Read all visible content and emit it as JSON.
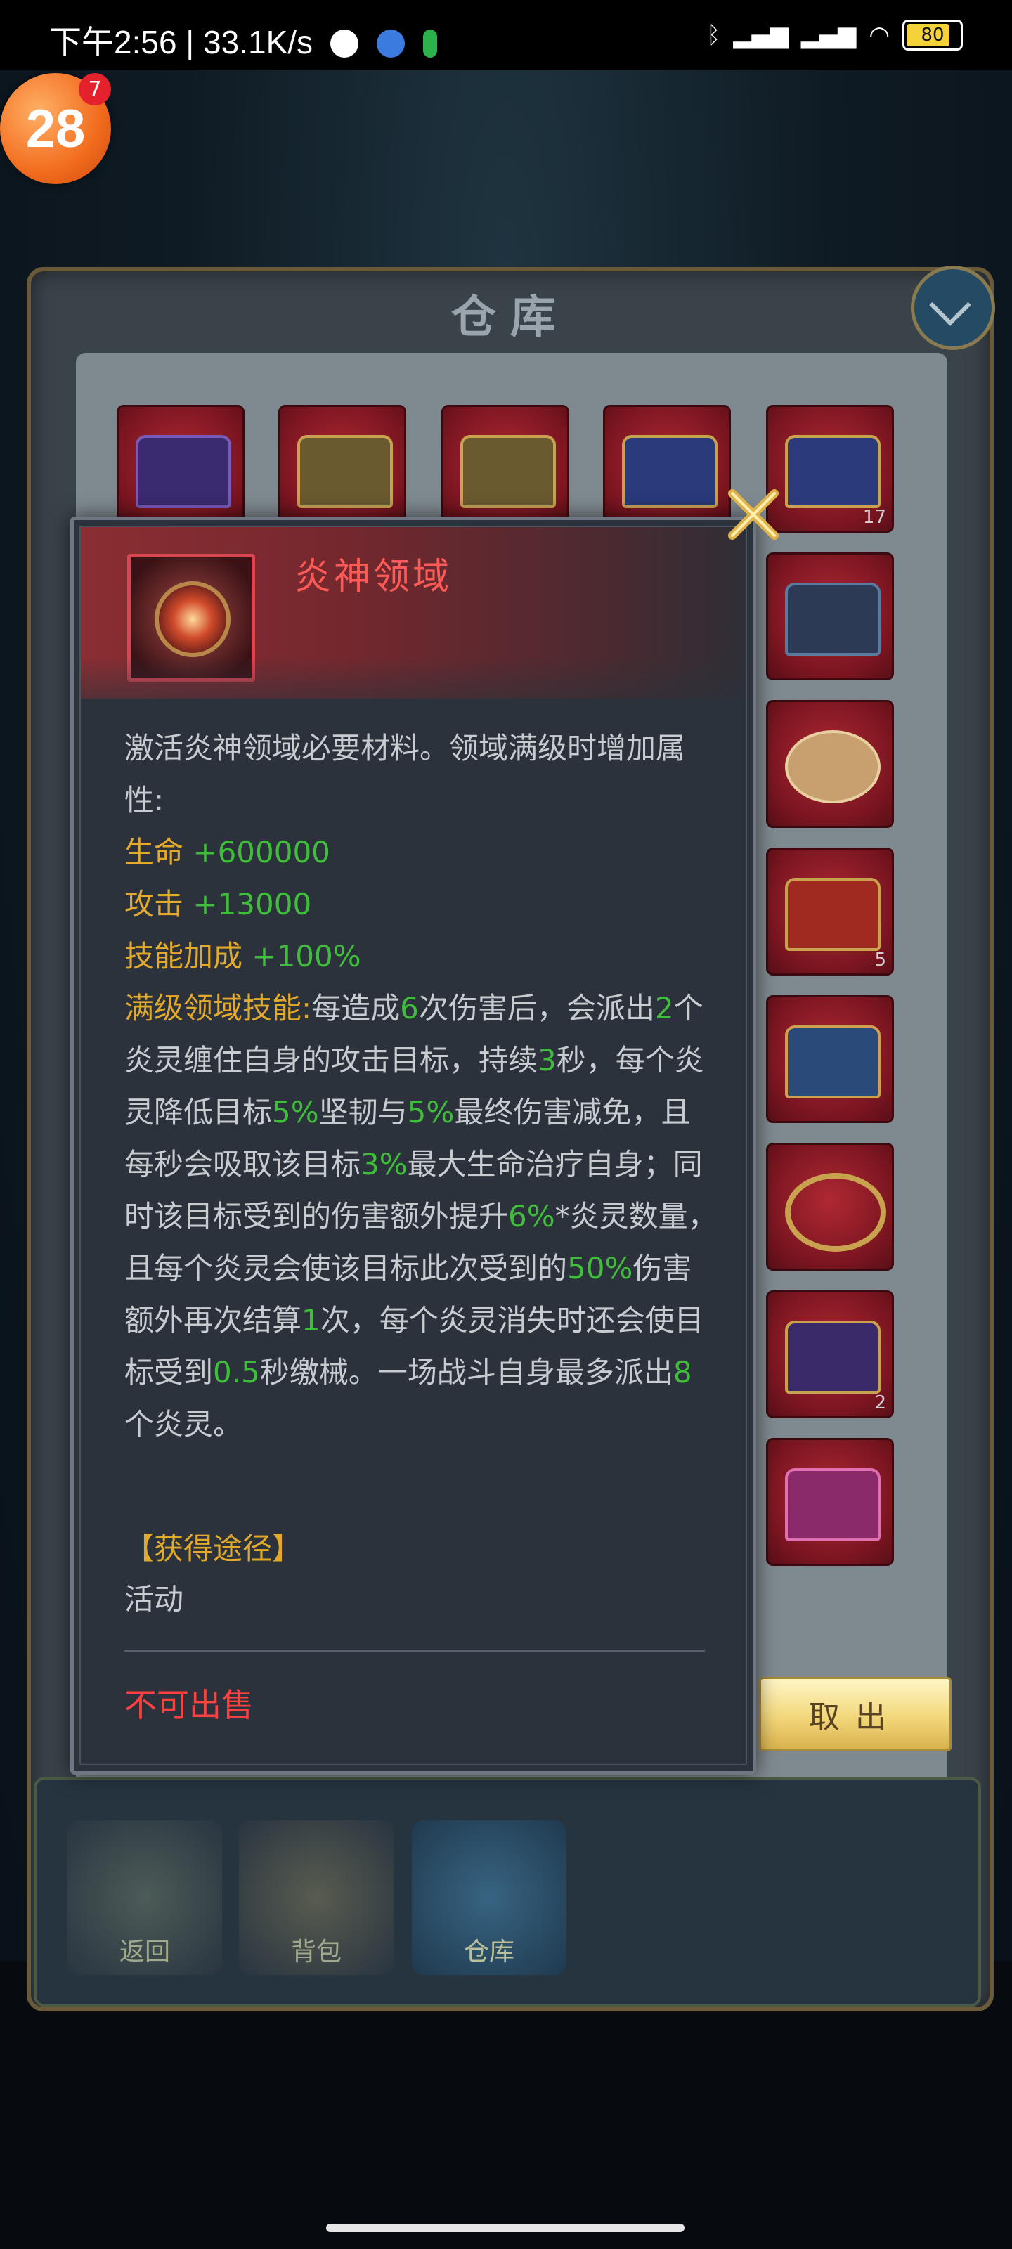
{
  "status_bar": {
    "time": "下午2:56 | 33.1K/s",
    "battery": "80"
  },
  "floating_badge": {
    "number": "28",
    "notification_count": "7"
  },
  "warehouse": {
    "title": "仓库",
    "take_out_label": "取出",
    "slot_counts": [
      "",
      "",
      "",
      "",
      "17",
      "",
      "",
      "5",
      "",
      "",
      "2",
      ""
    ],
    "nav": [
      {
        "label": "返回"
      },
      {
        "label": "背包"
      },
      {
        "label": "仓库"
      }
    ]
  },
  "item": {
    "name": "炎神领域",
    "description_intro": "激活炎神领域必要材料。领域满级时增加属性:",
    "stats": [
      {
        "label": "生命",
        "value": "+600000"
      },
      {
        "label": "攻击",
        "value": "+13000"
      },
      {
        "label": "技能加成",
        "value": "+100%"
      }
    ],
    "skill_label": "满级领域技能:",
    "skill_segments": [
      {
        "t": "每造成",
        "c": "n"
      },
      {
        "t": "6",
        "c": "g"
      },
      {
        "t": "次伤害后，会派出",
        "c": "n"
      },
      {
        "t": "2",
        "c": "g"
      },
      {
        "t": "个炎灵缠住自身的攻击目标，持续",
        "c": "n"
      },
      {
        "t": "3",
        "c": "g"
      },
      {
        "t": "秒，每个炎灵降低目标",
        "c": "n"
      },
      {
        "t": "5%",
        "c": "g"
      },
      {
        "t": "坚韧与",
        "c": "n"
      },
      {
        "t": "5%",
        "c": "g"
      },
      {
        "t": "最终伤害减免，且每秒会吸取该目标",
        "c": "n"
      },
      {
        "t": "3%",
        "c": "g"
      },
      {
        "t": "最大生命治疗自身；同时该目标受到的伤害额外提升",
        "c": "n"
      },
      {
        "t": "6%",
        "c": "g"
      },
      {
        "t": "*炎灵数量，且每个炎灵会使该目标此次受到的",
        "c": "n"
      },
      {
        "t": "50%",
        "c": "g"
      },
      {
        "t": "伤害额外再次结算",
        "c": "n"
      },
      {
        "t": "1",
        "c": "g"
      },
      {
        "t": "次，每个炎灵消失时还会使目标受到",
        "c": "n"
      },
      {
        "t": "0.5",
        "c": "g"
      },
      {
        "t": "秒缴械。一场战斗自身最多派出",
        "c": "n"
      },
      {
        "t": "8",
        "c": "g"
      },
      {
        "t": "个炎灵。",
        "c": "n"
      }
    ],
    "source_title": "【获得途径】",
    "source_value": "活动",
    "sell_status": "不可出售"
  }
}
